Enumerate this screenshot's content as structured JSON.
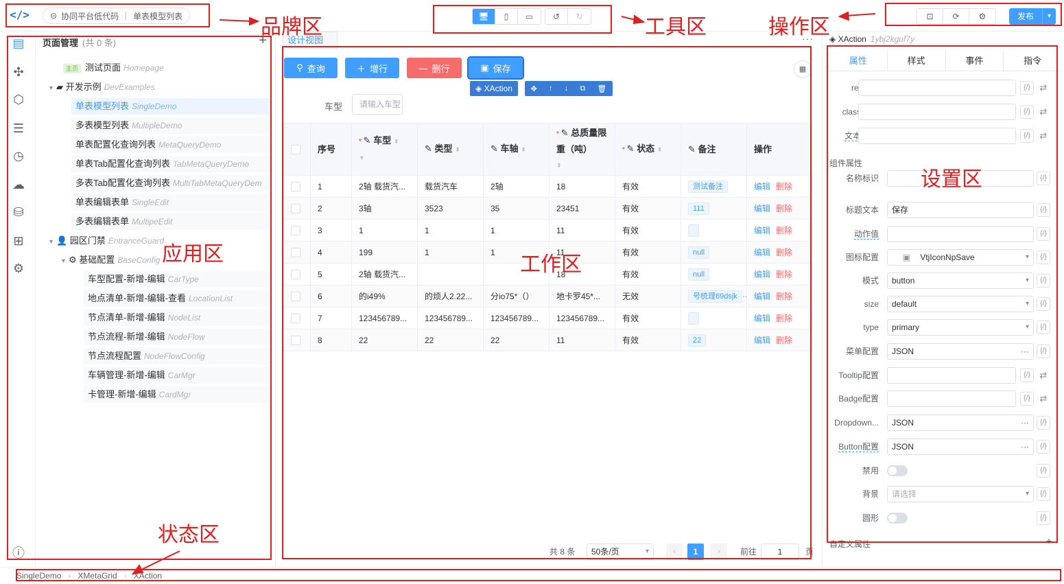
{
  "header": {
    "back_label": "协同平台低代码",
    "current_page": "单表模型列表",
    "publish_label": "发布"
  },
  "annotations": {
    "brand": "品牌区",
    "tools": "工具区",
    "actions": "操作区",
    "app": "应用区",
    "work": "工作区",
    "settings": "设置区",
    "status": "状态区"
  },
  "tree": {
    "title": "页面管理",
    "count": "(共 0 条)",
    "home_tag": "主页",
    "items": [
      {
        "label": "测试页面",
        "en": "Homepage"
      },
      {
        "label": "开发示例",
        "en": "DevExamples"
      },
      {
        "label": "单表模型列表",
        "en": "SingleDemo"
      },
      {
        "label": "多表模型列表",
        "en": "MultipleDemo"
      },
      {
        "label": "单表配置化查询列表",
        "en": "MetaQueryDemo"
      },
      {
        "label": "单表Tab配置化查询列表",
        "en": "TabMetaQueryDemo"
      },
      {
        "label": "多表Tab配置化查询列表",
        "en": "MultiTabMetaQueryDem"
      },
      {
        "label": "单表编辑表单",
        "en": "SingleEdit"
      },
      {
        "label": "多表编辑表单",
        "en": "MultipeEdit"
      },
      {
        "label": "园区门禁",
        "en": "EntranceGuard"
      },
      {
        "label": "基础配置",
        "en": "BaseConfig"
      },
      {
        "label": "车型配置-新增-编辑",
        "en": "CarType"
      },
      {
        "label": "地点清单-新增-编辑-查看",
        "en": "LocationList"
      },
      {
        "label": "节点清单-新增-编辑",
        "en": "NodeList"
      },
      {
        "label": "节点流程-新增-编辑",
        "en": "NodeFlow"
      },
      {
        "label": "节点流程配置",
        "en": "NodeFlowConfig"
      },
      {
        "label": "车辆管理-新增-编辑",
        "en": "CarMgr"
      },
      {
        "label": "卡管理-新增-编辑",
        "en": "CardMgr"
      }
    ]
  },
  "work": {
    "tab": "设计视图",
    "buttons": {
      "query": "查询",
      "add": "增行",
      "delete": "删行",
      "save": "保存"
    },
    "xaction": "XAction",
    "filter_label": "车型",
    "filter_placeholder": "请输入车型",
    "columns": [
      "序号",
      "车型",
      "类型",
      "车轴",
      "总质量限重（吨）",
      "状态",
      "备注",
      "操作"
    ],
    "edit_label": "编辑",
    "delete_label": "删除",
    "rows": [
      {
        "no": "1",
        "cartype": "2轴 载货汽...",
        "type": "载货汽车",
        "axle": "2轴",
        "weight": "18",
        "status": "有效",
        "note": "测试备注"
      },
      {
        "no": "2",
        "cartype": "3轴",
        "type": "3523",
        "axle": "35",
        "weight": "23451",
        "status": "有效",
        "note": "111"
      },
      {
        "no": "3",
        "cartype": "1",
        "type": "1",
        "axle": "1",
        "weight": "11",
        "status": "有效",
        "note": ""
      },
      {
        "no": "4",
        "cartype": "199",
        "type": "1",
        "axle": "1",
        "weight": "11",
        "status": "有效",
        "note": "null"
      },
      {
        "no": "5",
        "cartype": "2轴 载货汽...",
        "type": "",
        "axle": "",
        "weight": "18",
        "status": "有效",
        "note": "null"
      },
      {
        "no": "6",
        "cartype": "的i49%",
        "type": "的烦人2.22...",
        "axle": "分io75*（）",
        "weight": "地卡罗45*...",
        "status": "无效",
        "note": "号梳理89dsjk"
      },
      {
        "no": "7",
        "cartype": "123456789...",
        "type": "123456789...",
        "axle": "123456789...",
        "weight": "123456789...",
        "status": "有效",
        "note": ""
      },
      {
        "no": "8",
        "cartype": "22",
        "type": "22",
        "axle": "22",
        "weight": "11",
        "status": "有效",
        "note": "22"
      }
    ],
    "pager": {
      "total": "共 8 条",
      "size": "50条/页",
      "current": "1",
      "goto": "前往",
      "goto_value": "1",
      "page_unit": "页"
    }
  },
  "settings": {
    "component": "XAction",
    "component_id": "1ybj2kguf7y",
    "tabs": [
      "属性",
      "样式",
      "事件",
      "指令"
    ],
    "base_fields": [
      {
        "label": "ref",
        "value": ""
      },
      {
        "label": "class",
        "value": ""
      },
      {
        "label": "文本",
        "value": ""
      }
    ],
    "section_title": "组件属性",
    "props": [
      {
        "label": "名称标识",
        "value": ""
      },
      {
        "label": "标题文本",
        "value": "保存"
      },
      {
        "label": "动作值",
        "value": ""
      },
      {
        "label": "图标配置",
        "value": "VtjIconNpSave"
      },
      {
        "label": "模式",
        "value": "button"
      },
      {
        "label": "size",
        "value": "default"
      },
      {
        "label": "type",
        "value": "primary"
      },
      {
        "label": "菜单配置",
        "value": "JSON"
      },
      {
        "label": "Tooltip配置",
        "value": ""
      },
      {
        "label": "Badge配置",
        "value": ""
      },
      {
        "label": "Dropdown...",
        "value": "JSON"
      },
      {
        "label": "Button配置",
        "value": "JSON"
      },
      {
        "label": "禁用",
        "value": ""
      },
      {
        "label": "背景",
        "value": "请选择"
      },
      {
        "label": "圆形",
        "value": ""
      }
    ],
    "custom_title": "自定义属性"
  },
  "status": {
    "path": [
      "SingleDemo",
      "XMetaGrid",
      "XAction"
    ]
  }
}
